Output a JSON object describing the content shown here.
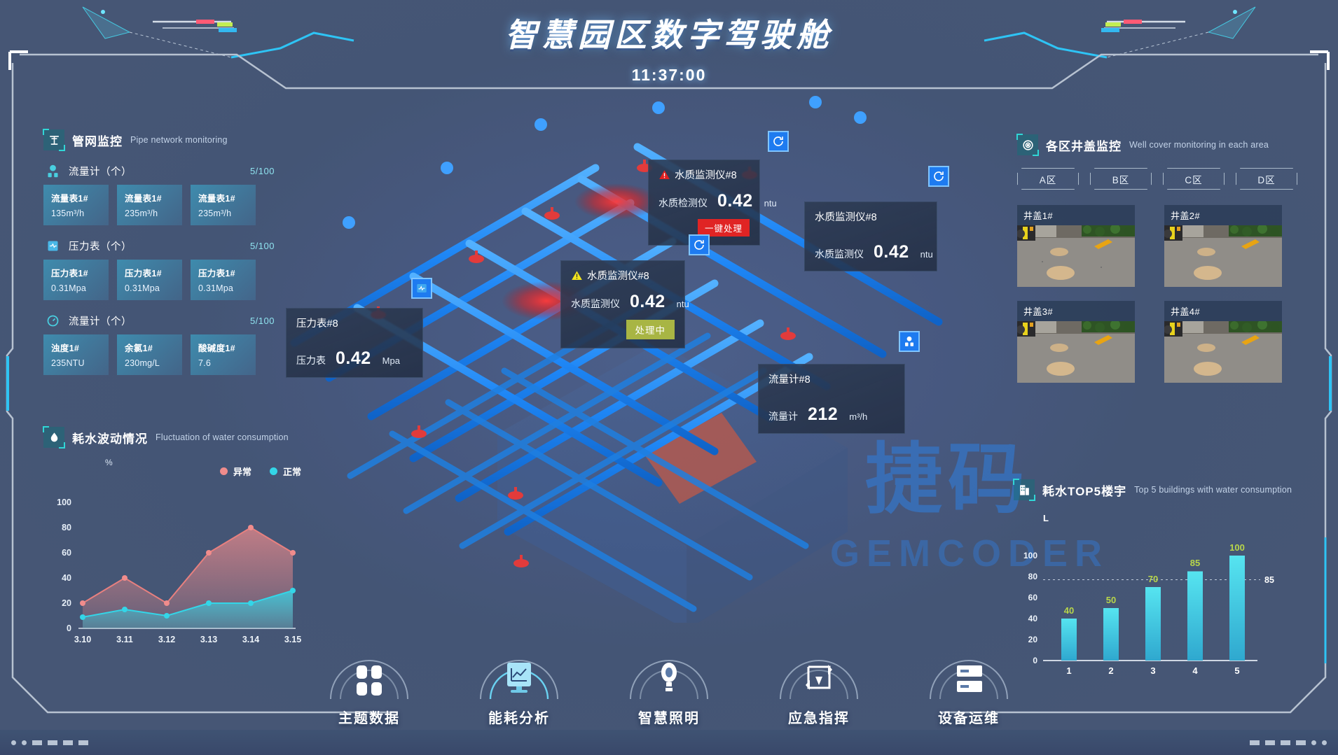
{
  "header": {
    "title": "智慧园区数字驾驶舱",
    "clock": "11:37:00"
  },
  "left_panel": {
    "section": {
      "cn": "管网监控",
      "en": "Pipe network monitoring",
      "icon": "pipe-network-icon"
    },
    "groups": [
      {
        "icon": "flow-meter-icon",
        "label": "流量计（个）",
        "count": "5/100",
        "cards": [
          {
            "title": "流量表1#",
            "value": "135m³/h"
          },
          {
            "title": "流量表1#",
            "value": "235m³/h"
          },
          {
            "title": "流量表1#",
            "value": "235m³/h"
          }
        ]
      },
      {
        "icon": "pressure-gauge-icon",
        "label": "压力表（个）",
        "count": "5/100",
        "cards": [
          {
            "title": "压力表1#",
            "value": "0.31Mpa"
          },
          {
            "title": "压力表1#",
            "value": "0.31Mpa"
          },
          {
            "title": "压力表1#",
            "value": "0.31Mpa"
          }
        ]
      },
      {
        "icon": "dial-gauge-icon",
        "label": "流量计（个）",
        "count": "5/100",
        "cards": [
          {
            "title": "浊度1#",
            "value": "235NTU"
          },
          {
            "title": "余氯1#",
            "value": "230mg/L"
          },
          {
            "title": "酸碱度1#",
            "value": "7.6"
          }
        ]
      }
    ],
    "water_section": {
      "cn": "耗水波动情况",
      "en": "Fluctuation of water consumption",
      "icon": "water-drop-icon"
    }
  },
  "right_panel": {
    "section": {
      "cn": "各区井盖监控",
      "en": "Well cover monitoring in each area",
      "icon": "target-icon"
    },
    "area_tabs": [
      "A区",
      "B区",
      "C区",
      "D区"
    ],
    "cameras": [
      {
        "label": "井盖1#"
      },
      {
        "label": "井盖2#"
      },
      {
        "label": "井盖3#"
      },
      {
        "label": "井盖4#"
      }
    ],
    "top5_section": {
      "cn": "耗水TOP5楼宇",
      "en": "Top 5 buildings with water consumption",
      "icon": "building-icon"
    }
  },
  "popups": [
    {
      "id": "water-quality-8-alarm",
      "severity": "alarm",
      "alert_icon": "warning-triangle-red-icon",
      "title": "水质监测仪#8",
      "name": "水质检测仪",
      "value": "0.42",
      "unit": "ntu",
      "action": "一键处理",
      "badge_icon": "refresh-icon"
    },
    {
      "id": "water-quality-8-processing",
      "severity": "warning",
      "alert_icon": "warning-triangle-yellow-icon",
      "title": "水质监测仪#8",
      "name": "水质监测仪",
      "value": "0.42",
      "unit": "ntu",
      "action": "处理中",
      "badge_icon": "refresh-icon"
    },
    {
      "id": "water-quality-8-normal",
      "severity": "normal",
      "alert_icon": "",
      "title": "水质监测仪#8",
      "name": "水质监测仪",
      "value": "0.42",
      "unit": "ntu",
      "action": "",
      "badge_icon": "refresh-icon"
    },
    {
      "id": "pressure-gauge-8",
      "severity": "normal",
      "alert_icon": "",
      "title": "压力表#8",
      "name": "压力表",
      "value": "0.42",
      "unit": "Mpa",
      "action": "",
      "badge_icon": "pressure-badge-icon"
    },
    {
      "id": "flow-meter-8",
      "severity": "normal",
      "alert_icon": "",
      "title": "流量计#8",
      "name": "流量计",
      "value": "212",
      "unit": "m³/h",
      "action": "",
      "badge_icon": "flow-badge-icon"
    }
  ],
  "bottom_nav": [
    {
      "label": "主题数据",
      "icon": "grid-squares-icon"
    },
    {
      "label": "能耗分析",
      "icon": "chart-monitor-icon"
    },
    {
      "label": "智慧照明",
      "icon": "lightbulb-icon"
    },
    {
      "label": "应急指挥",
      "icon": "emergency-arrow-icon"
    },
    {
      "label": "设备运维",
      "icon": "server-rack-icon"
    }
  ],
  "colors": {
    "abnormal": "#f08c8c",
    "normal": "#33d6e8",
    "bar": "#3fd0e8",
    "accent": "#30d6d6",
    "alarm_red": "#e02424",
    "processing_olive": "#a8b544",
    "label_green": "#b8d64a"
  },
  "chart_data": [
    {
      "type": "area",
      "title": "耗水波动情况",
      "subtitle": "Fluctuation of water consumption",
      "xlabel": "",
      "ylabel": "%",
      "ylim": [
        0,
        100
      ],
      "yticks": [
        0,
        20,
        40,
        60,
        80,
        100
      ],
      "categories": [
        "3.10",
        "3.11",
        "3.12",
        "3.13",
        "3.14",
        "3.15"
      ],
      "grid": false,
      "legend_position": "top-right",
      "series": [
        {
          "name": "异常",
          "color": "#f08c8c",
          "values": [
            20,
            40,
            20,
            60,
            80,
            60
          ]
        },
        {
          "name": "正常",
          "color": "#33d6e8",
          "values": [
            9,
            15,
            10,
            20,
            20,
            30
          ]
        }
      ]
    },
    {
      "type": "bar",
      "title": "耗水TOP5楼宇",
      "subtitle": "Top 5 buildings with water consumption",
      "xlabel": "",
      "ylabel": "L",
      "ylim": [
        0,
        110
      ],
      "yticks": [
        0,
        20,
        40,
        60,
        80,
        100
      ],
      "categories": [
        "1",
        "2",
        "3",
        "4",
        "5"
      ],
      "values": [
        40,
        50,
        70,
        85,
        100
      ],
      "data_labels": [
        "40",
        "50",
        "70",
        "85",
        "100"
      ],
      "markline": {
        "value": 85,
        "label": "85"
      },
      "grid": false,
      "legend_position": "none"
    }
  ]
}
